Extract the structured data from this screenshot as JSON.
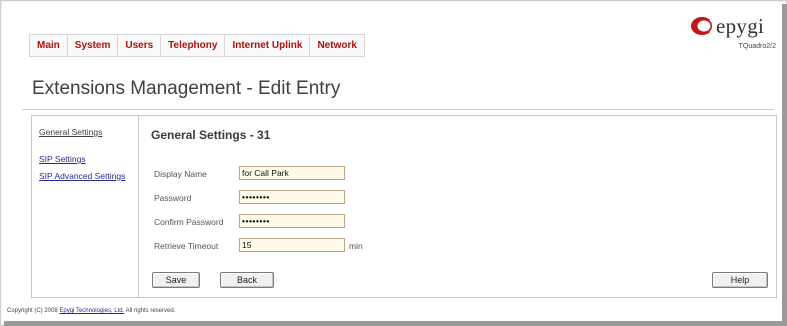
{
  "menu": {
    "items": [
      {
        "label": "Main"
      },
      {
        "label": "System"
      },
      {
        "label": "Users"
      },
      {
        "label": "Telephony"
      },
      {
        "label": "Internet Uplink"
      },
      {
        "label": "Network"
      }
    ]
  },
  "logo": {
    "text": "epygi",
    "subtitle": "TQuadro2/2"
  },
  "page": {
    "title": "Extensions Management - Edit Entry"
  },
  "sidebar": {
    "items": [
      {
        "label": "General Settings"
      },
      {
        "label": "SIP Settings"
      },
      {
        "label": "SIP Advanced Settings"
      }
    ]
  },
  "form": {
    "section_title": "General Settings - 31",
    "display_name": {
      "label": "Display Name",
      "value": "for Call Park"
    },
    "password": {
      "label": "Password",
      "value": "••••••••"
    },
    "confirm_password": {
      "label": "Confirm Password",
      "value": "••••••••"
    },
    "retrieve_timeout": {
      "label": "Retrieve Timeout",
      "value": "15",
      "unit": "min"
    }
  },
  "buttons": {
    "save": "Save",
    "back": "Back",
    "help": "Help"
  },
  "footer": {
    "prefix": "Copyright (C) 2008",
    "company": "Epygi Technologies, Ltd.",
    "suffix": "All rights reserved."
  },
  "colors": {
    "menu_text": "#b01010",
    "logo_mark": "#c01818",
    "link": "#2a2a8a",
    "field_bg": "#fffbe8"
  }
}
